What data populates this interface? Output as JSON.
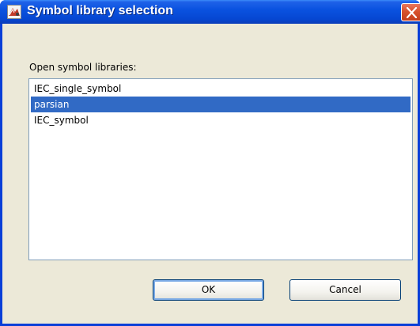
{
  "window": {
    "title": "Symbol library selection",
    "title_icon": "symbol-library-app-icon",
    "close_icon": "close-icon"
  },
  "dialog": {
    "prompt_label": "Open symbol libraries:",
    "libraries": [
      "IEC_single_symbol",
      "parsian",
      "IEC_symbol"
    ],
    "selected_library": "parsian",
    "ok_label": "OK",
    "cancel_label": "Cancel"
  },
  "colors": {
    "titlebar_blue": "#0a52e0",
    "selection_blue": "#316ac5",
    "close_red": "#d8512d",
    "dialog_background": "#ece9d8"
  }
}
